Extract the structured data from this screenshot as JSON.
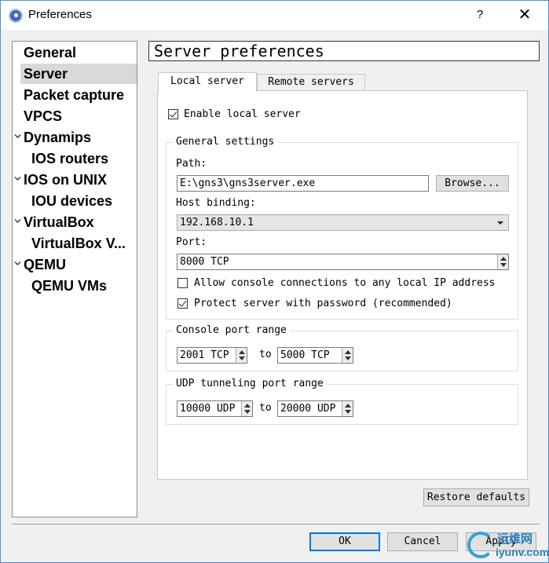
{
  "window": {
    "title": "Preferences",
    "help_label": "?",
    "close_label": "✕"
  },
  "sidebar": {
    "items": [
      {
        "label": "General",
        "level": 0,
        "expandable": false,
        "selected": false
      },
      {
        "label": "Server",
        "level": 0,
        "expandable": false,
        "selected": true
      },
      {
        "label": "Packet capture",
        "level": 0,
        "expandable": false,
        "selected": false
      },
      {
        "label": "VPCS",
        "level": 0,
        "expandable": false,
        "selected": false
      },
      {
        "label": "Dynamips",
        "level": 0,
        "expandable": true,
        "selected": false
      },
      {
        "label": "IOS routers",
        "level": 1,
        "expandable": false,
        "selected": false
      },
      {
        "label": "IOS on UNIX",
        "level": 0,
        "expandable": true,
        "selected": false
      },
      {
        "label": "IOU devices",
        "level": 1,
        "expandable": false,
        "selected": false
      },
      {
        "label": "VirtualBox",
        "level": 0,
        "expandable": true,
        "selected": false
      },
      {
        "label": "VirtualBox V...",
        "level": 1,
        "expandable": false,
        "selected": false
      },
      {
        "label": "QEMU",
        "level": 0,
        "expandable": true,
        "selected": false
      },
      {
        "label": "QEMU VMs",
        "level": 1,
        "expandable": false,
        "selected": false
      }
    ]
  },
  "page": {
    "title": "Server preferences"
  },
  "tabs": [
    {
      "label": "Local server",
      "active": true
    },
    {
      "label": "Remote servers",
      "active": false
    }
  ],
  "local_server": {
    "enable_label": "Enable local server",
    "enable_checked": true,
    "general": {
      "title": "General settings",
      "path_label": "Path:",
      "path_value": "E:\\gns3\\gns3server.exe",
      "browse_label": "Browse...",
      "host_label": "Host binding:",
      "host_value": "192.168.10.1",
      "port_label": "Port:",
      "port_value": "8000 TCP",
      "allow_console_label": "Allow console connections to any local IP address",
      "allow_console_checked": false,
      "protect_label": "Protect server with password (recommended)",
      "protect_checked": true
    },
    "console_range": {
      "title": "Console port range",
      "from": "2001 TCP",
      "to_label": "to",
      "to": "5000 TCP"
    },
    "udp_range": {
      "title": "UDP tunneling port range",
      "from": "10000 UDP",
      "to_label": "to",
      "to": "20000 UDP"
    }
  },
  "buttons": {
    "restore": "Restore defaults",
    "ok": "OK",
    "cancel": "Cancel",
    "apply": "Apply"
  },
  "watermark": {
    "top": "运维网",
    "bottom": "iyunv.com",
    "color": "#2b7fc0"
  }
}
